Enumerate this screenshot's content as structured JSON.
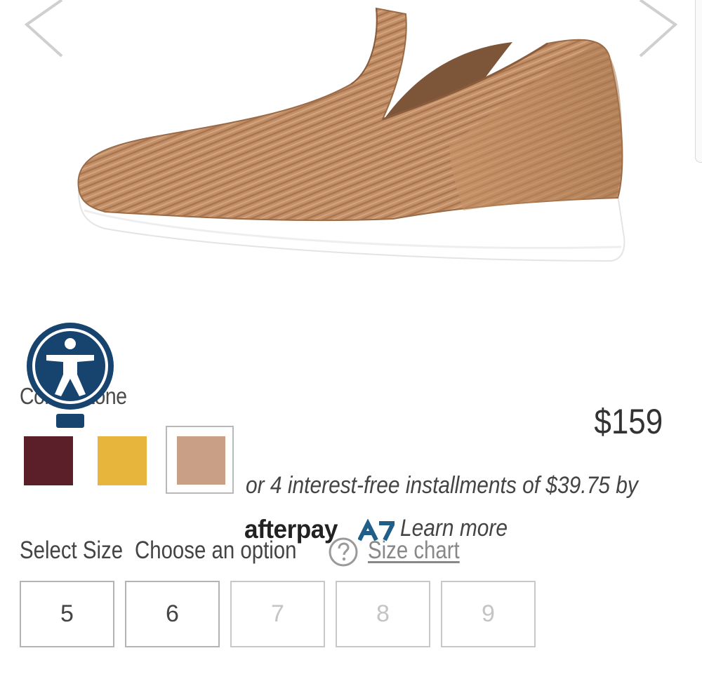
{
  "gallery": {
    "image": "slip-on-sneaker-photo",
    "prev_icon": "chevron-left-icon",
    "next_icon": "chevron-right-icon"
  },
  "accessibility": {
    "icon": "accessibility-icon",
    "color": "#17446e"
  },
  "product": {
    "color_label": "Color: Stone",
    "price": "$159",
    "swatches": [
      {
        "name": "wine",
        "color": "#5a1f28"
      },
      {
        "name": "mustard",
        "color": "#e7b43c"
      },
      {
        "name": "stone",
        "color": "#c99f85",
        "selected": true
      }
    ]
  },
  "afterpay": {
    "installments_text": "or 4 interest-free installments of $39.75 by",
    "logo_text": "afterpay",
    "learn_more": "Learn more"
  },
  "size": {
    "label": "Select Size",
    "option_placeholder": "Choose an option",
    "help_icon": "question-circle-icon",
    "chart_link": "Size chart",
    "options": [
      {
        "label": "5",
        "available": true
      },
      {
        "label": "6",
        "available": true
      },
      {
        "label": "7",
        "available": false
      },
      {
        "label": "8",
        "available": false
      },
      {
        "label": "9",
        "available": false
      }
    ]
  }
}
